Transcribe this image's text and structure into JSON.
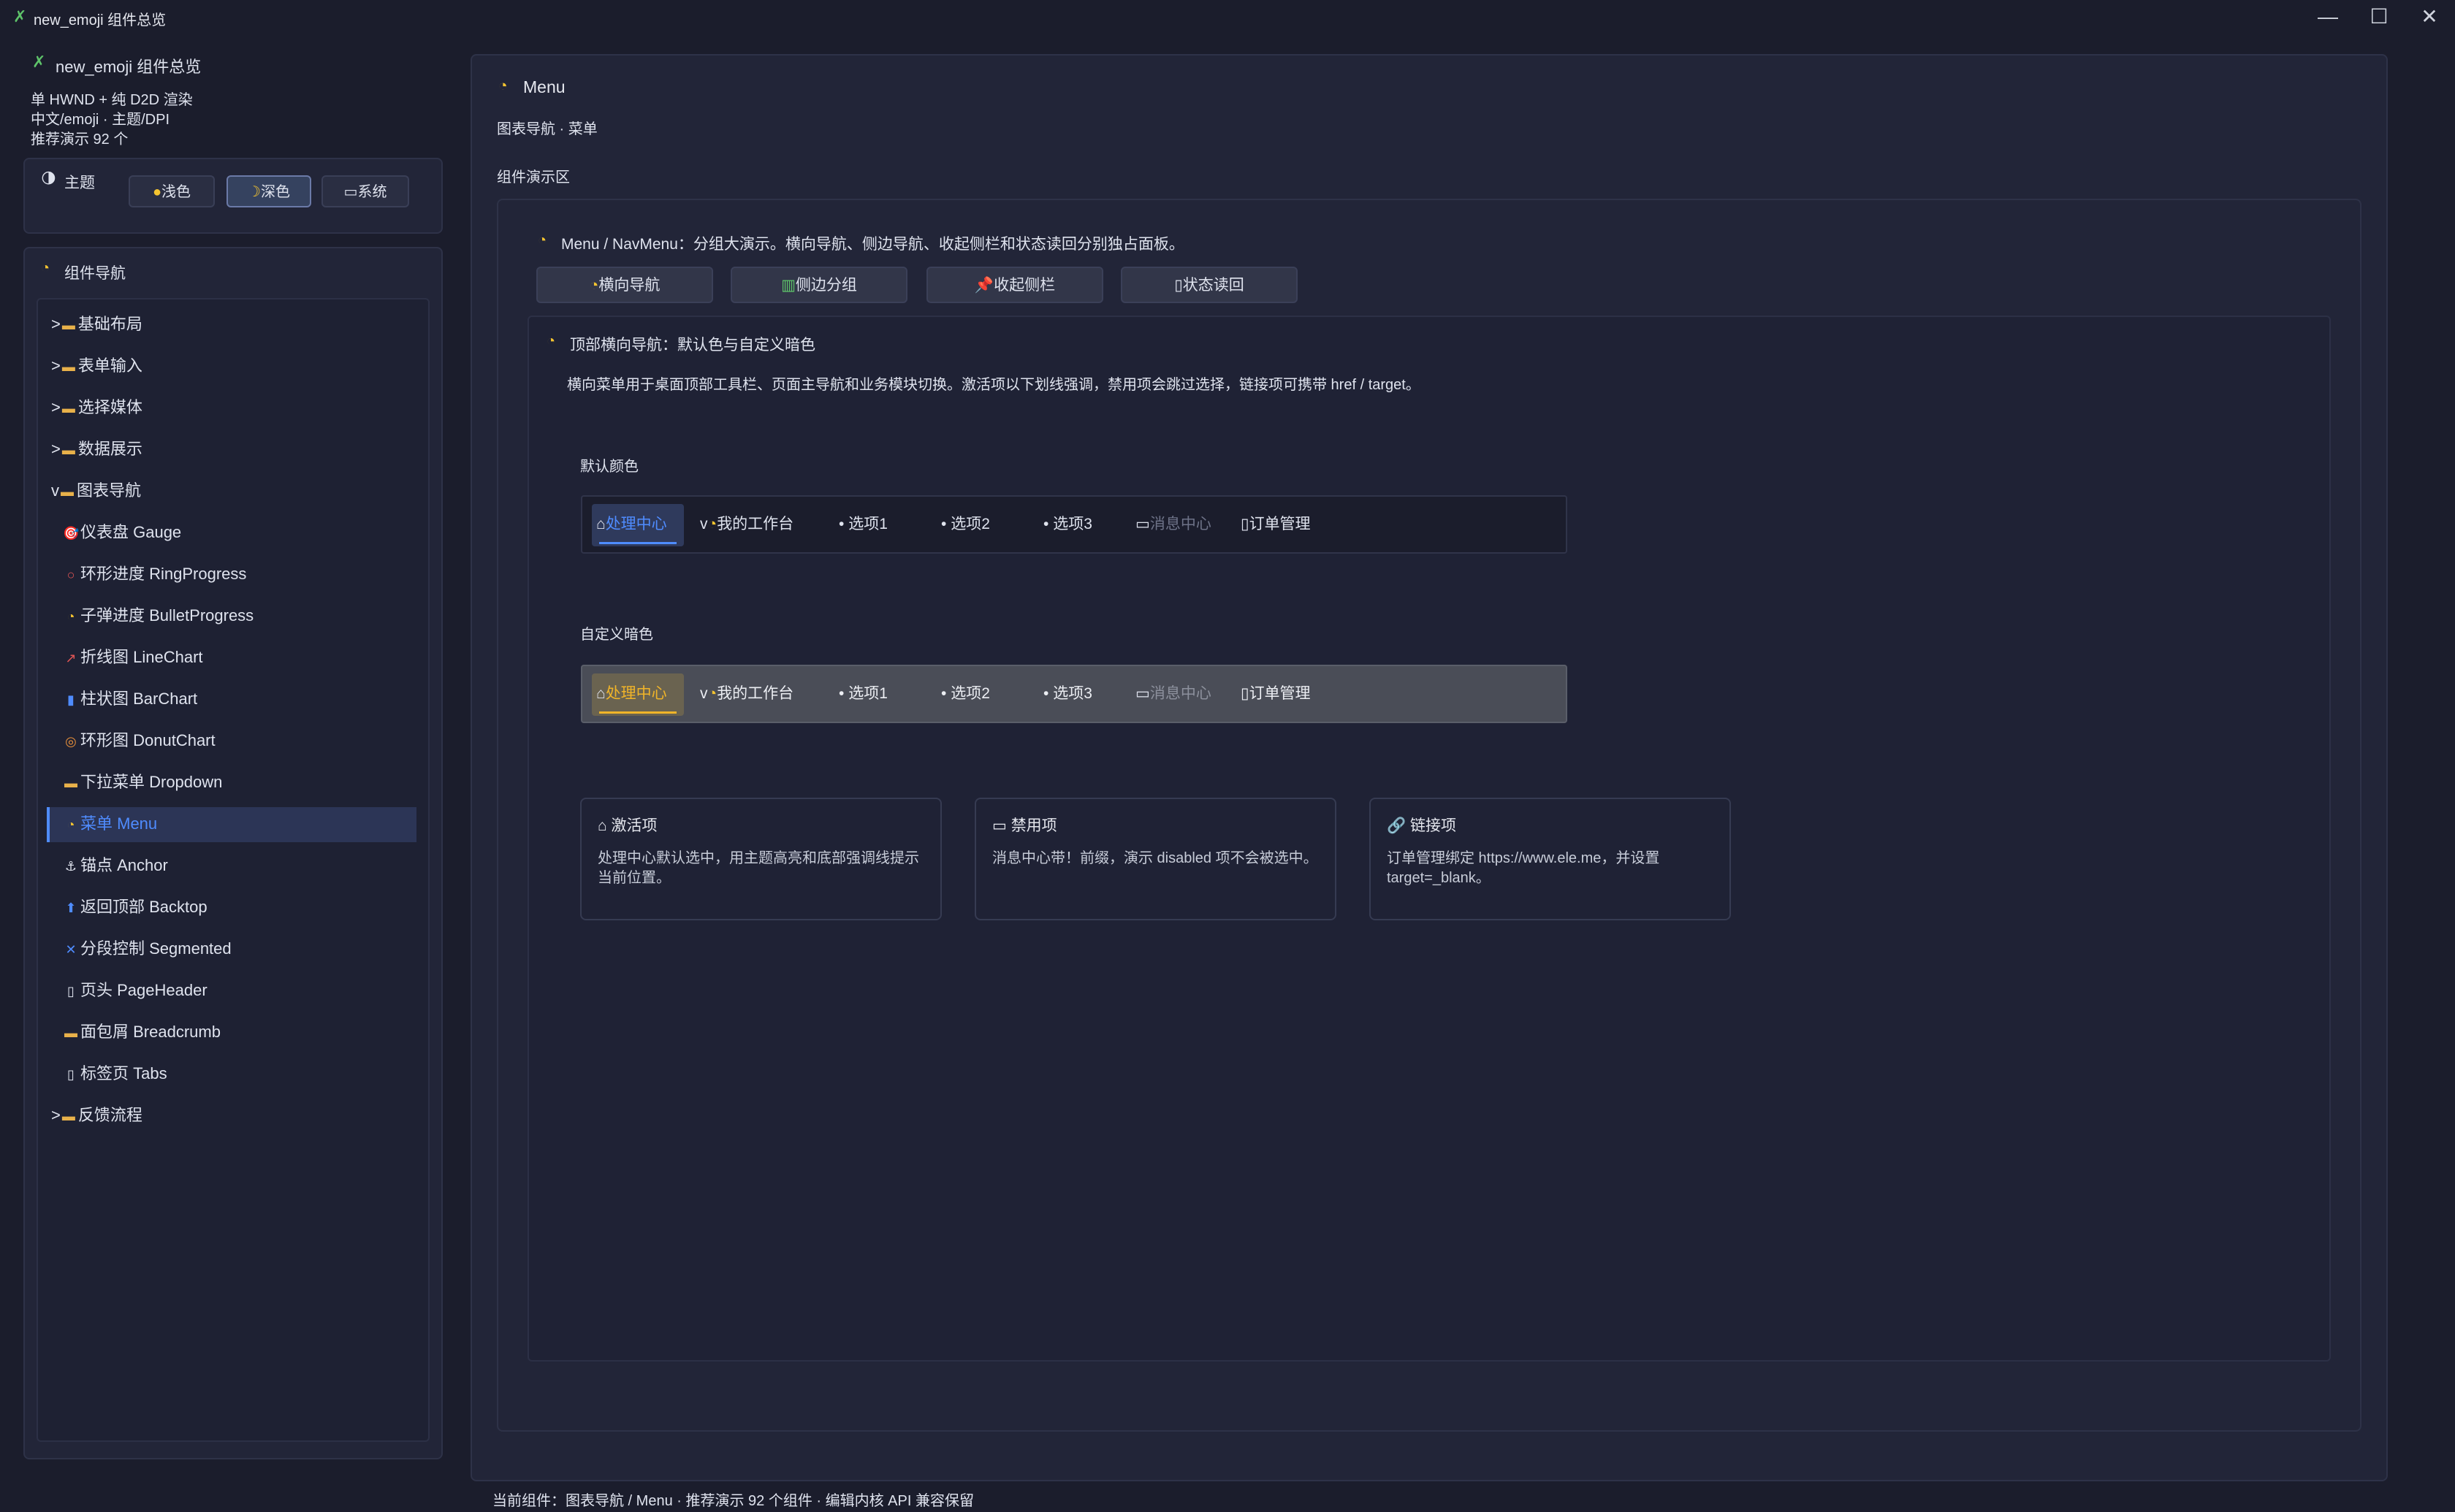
{
  "window": {
    "title": "new_emoji 组件总览"
  },
  "sidebar": {
    "app_title": "new_emoji 组件总览",
    "info_lines": [
      "单 HWND + 纯 D2D 渲染",
      "中文/emoji · 主题/DPI",
      "推荐演示 92 个"
    ],
    "theme": {
      "label": "主题",
      "options": [
        {
          "label": "浅色",
          "icon": "🌕"
        },
        {
          "label": "深色",
          "icon": "🌙"
        },
        {
          "label": "系统",
          "icon": "💻"
        }
      ],
      "selected": "深色"
    },
    "nav_title": "组件导航",
    "groups": [
      {
        "marker": ">",
        "label": "基础布局"
      },
      {
        "marker": ">",
        "label": "表单输入"
      },
      {
        "marker": ">",
        "label": "选择媒体"
      },
      {
        "marker": ">",
        "label": "数据展示"
      },
      {
        "marker": "v",
        "label": "图表导航"
      }
    ],
    "sub_items": [
      {
        "icon": "🎯",
        "label": "仪表盘 Gauge"
      },
      {
        "icon": "⭕",
        "label": "环形进度 RingProgress"
      },
      {
        "icon": "🕒",
        "label": "子弹进度 BulletProgress"
      },
      {
        "icon": "📈",
        "label": "折线图 LineChart"
      },
      {
        "icon": "📊",
        "label": "柱状图 BarChart"
      },
      {
        "icon": "🍩",
        "label": "环形图 DonutChart"
      },
      {
        "icon": "📂",
        "label": "下拉菜单 Dropdown"
      },
      {
        "icon": "🕒",
        "label": "菜单 Menu"
      },
      {
        "icon": "⚓",
        "label": "锚点 Anchor"
      },
      {
        "icon": "⬆",
        "label": "返回顶部 Backtop"
      },
      {
        "icon": "🔀",
        "label": "分段控制 Segmented"
      },
      {
        "icon": "📄",
        "label": "页头 PageHeader"
      },
      {
        "icon": "🍞",
        "label": "面包屑 Breadcrumb"
      },
      {
        "icon": "📑",
        "label": "标签页 Tabs"
      }
    ],
    "last_group": {
      "marker": ">",
      "label": "反馈流程"
    }
  },
  "main": {
    "title": "Menu",
    "subtitle": "图表导航 · 菜单",
    "demo_area_label": "组件演示区",
    "intro": "Menu / NavMenu：分组大演示。横向导航、侧边导航、收起侧栏和状态读回分别独占面板。",
    "demo_tabs": [
      {
        "icon": "🕒",
        "label": "横向导航"
      },
      {
        "icon": "📚",
        "label": "侧边分组"
      },
      {
        "icon": "📌",
        "label": "收起侧栏"
      },
      {
        "icon": "📄",
        "label": "状态读回"
      }
    ],
    "panel": {
      "title": "顶部横向导航：默认色与自定义暗色",
      "desc": "横向菜单用于桌面顶部工具栏、页面主导航和业务模块切换。激活项以下划线强调，禁用项会跳过选择，链接项可携带 href / target。",
      "default_label": "默认颜色",
      "custom_label": "自定义暗色",
      "menu_items": [
        {
          "icon": "🏠",
          "label": "处理中心"
        },
        {
          "icon": "🕒",
          "label": "我的工作台",
          "marker": "v"
        },
        {
          "icon": "•",
          "label": "选项1"
        },
        {
          "icon": "•",
          "label": "选项2"
        },
        {
          "icon": "•",
          "label": "选项3"
        },
        {
          "icon": "💬",
          "label": "消息中心"
        },
        {
          "icon": "📄",
          "label": "订单管理"
        }
      ],
      "default_accent": "#4f8cff",
      "custom_accent": "#f0b429"
    },
    "info_cards": [
      {
        "icon": "🏠",
        "title": "激活项",
        "body": "处理中心默认选中，用主题高亮和底部强调线提示当前位置。"
      },
      {
        "icon": "💬",
        "title": "禁用项",
        "body": "消息中心带！前缀，演示 disabled 项不会被选中。"
      },
      {
        "icon": "🔗",
        "title": "链接项",
        "body": "订单管理绑定 https://www.ele.me，并设置 target=_blank。"
      }
    ]
  },
  "status_bar": {
    "text": "当前组件：图表导航 / Menu · 推荐演示 92 个组件 · 编辑内核 API 兼容保留"
  }
}
